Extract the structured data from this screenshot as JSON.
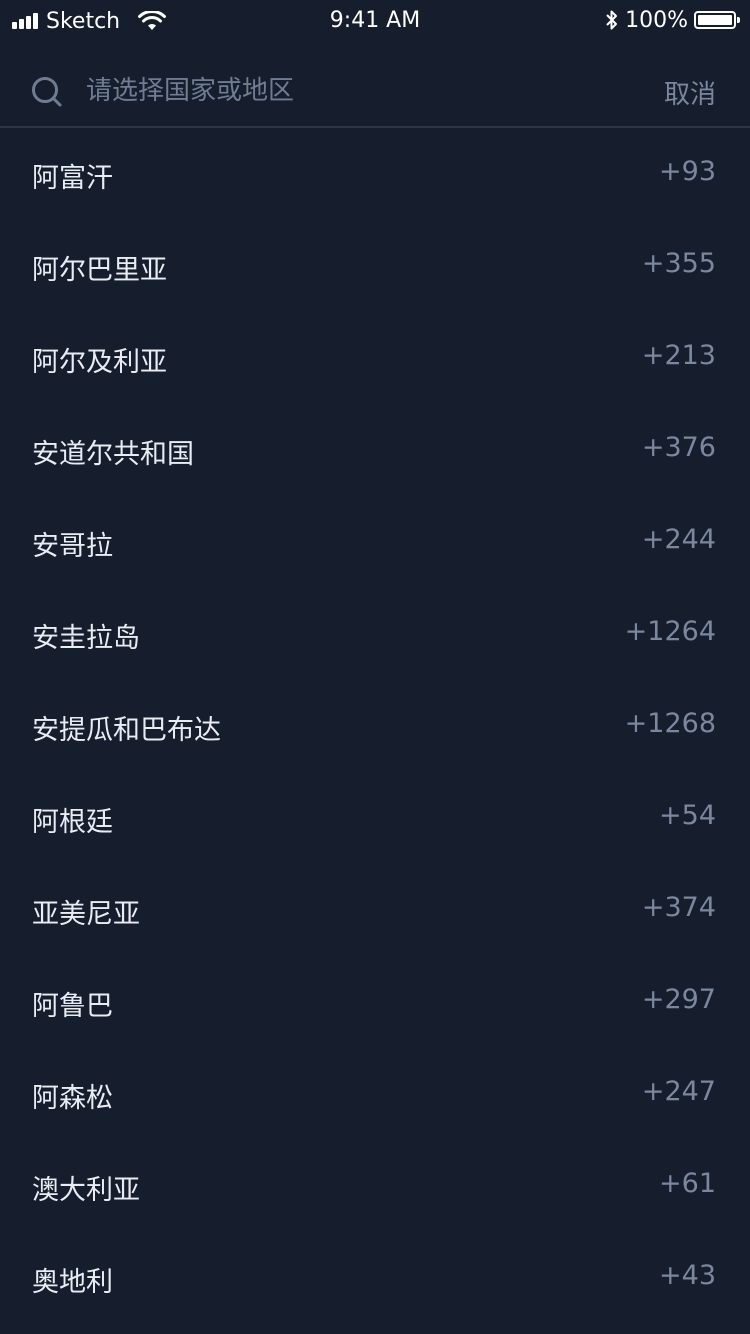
{
  "status_bar": {
    "carrier": "Sketch",
    "time": "9:41 AM",
    "battery_percent": "100%",
    "battery_level": 1.0,
    "icons": [
      "signal-icon",
      "wifi-icon",
      "bluetooth-icon",
      "battery-icon"
    ]
  },
  "search": {
    "placeholder": "请选择国家或地区",
    "value": "",
    "cancel_label": "取消"
  },
  "countries": [
    {
      "name": "阿富汗",
      "code": "+93"
    },
    {
      "name": "阿尔巴里亚",
      "code": "+355"
    },
    {
      "name": "阿尔及利亚",
      "code": "+213"
    },
    {
      "name": "安道尔共和国",
      "code": "+376"
    },
    {
      "name": "安哥拉",
      "code": "+244"
    },
    {
      "name": "安圭拉岛",
      "code": "+1264"
    },
    {
      "name": "安提瓜和巴布达",
      "code": "+1268"
    },
    {
      "name": "阿根廷",
      "code": "+54"
    },
    {
      "name": "亚美尼亚",
      "code": "+374"
    },
    {
      "name": "阿鲁巴",
      "code": "+297"
    },
    {
      "name": "阿森松",
      "code": "+247"
    },
    {
      "name": "澳大利亚",
      "code": "+61"
    },
    {
      "name": "奥地利",
      "code": "+43"
    }
  ],
  "colors": {
    "background": "#161e2e",
    "divider": "#2b3548",
    "primary_text": "#e9edf3",
    "secondary_text": "#7b879d"
  }
}
